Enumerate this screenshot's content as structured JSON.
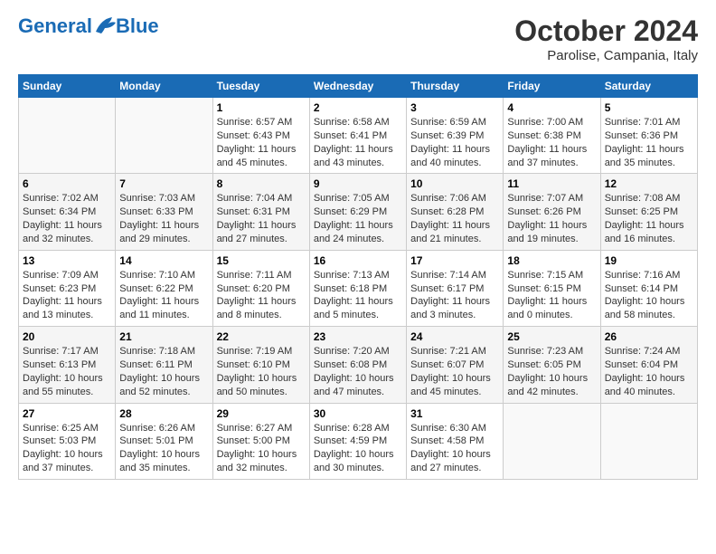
{
  "header": {
    "logo_line1": "General",
    "logo_line2": "Blue",
    "main_title": "October 2024",
    "subtitle": "Parolise, Campania, Italy"
  },
  "weekdays": [
    "Sunday",
    "Monday",
    "Tuesday",
    "Wednesday",
    "Thursday",
    "Friday",
    "Saturday"
  ],
  "weeks": [
    [
      {
        "num": "",
        "info": ""
      },
      {
        "num": "",
        "info": ""
      },
      {
        "num": "1",
        "info": "Sunrise: 6:57 AM\nSunset: 6:43 PM\nDaylight: 11 hours and 45 minutes."
      },
      {
        "num": "2",
        "info": "Sunrise: 6:58 AM\nSunset: 6:41 PM\nDaylight: 11 hours and 43 minutes."
      },
      {
        "num": "3",
        "info": "Sunrise: 6:59 AM\nSunset: 6:39 PM\nDaylight: 11 hours and 40 minutes."
      },
      {
        "num": "4",
        "info": "Sunrise: 7:00 AM\nSunset: 6:38 PM\nDaylight: 11 hours and 37 minutes."
      },
      {
        "num": "5",
        "info": "Sunrise: 7:01 AM\nSunset: 6:36 PM\nDaylight: 11 hours and 35 minutes."
      }
    ],
    [
      {
        "num": "6",
        "info": "Sunrise: 7:02 AM\nSunset: 6:34 PM\nDaylight: 11 hours and 32 minutes."
      },
      {
        "num": "7",
        "info": "Sunrise: 7:03 AM\nSunset: 6:33 PM\nDaylight: 11 hours and 29 minutes."
      },
      {
        "num": "8",
        "info": "Sunrise: 7:04 AM\nSunset: 6:31 PM\nDaylight: 11 hours and 27 minutes."
      },
      {
        "num": "9",
        "info": "Sunrise: 7:05 AM\nSunset: 6:29 PM\nDaylight: 11 hours and 24 minutes."
      },
      {
        "num": "10",
        "info": "Sunrise: 7:06 AM\nSunset: 6:28 PM\nDaylight: 11 hours and 21 minutes."
      },
      {
        "num": "11",
        "info": "Sunrise: 7:07 AM\nSunset: 6:26 PM\nDaylight: 11 hours and 19 minutes."
      },
      {
        "num": "12",
        "info": "Sunrise: 7:08 AM\nSunset: 6:25 PM\nDaylight: 11 hours and 16 minutes."
      }
    ],
    [
      {
        "num": "13",
        "info": "Sunrise: 7:09 AM\nSunset: 6:23 PM\nDaylight: 11 hours and 13 minutes."
      },
      {
        "num": "14",
        "info": "Sunrise: 7:10 AM\nSunset: 6:22 PM\nDaylight: 11 hours and 11 minutes."
      },
      {
        "num": "15",
        "info": "Sunrise: 7:11 AM\nSunset: 6:20 PM\nDaylight: 11 hours and 8 minutes."
      },
      {
        "num": "16",
        "info": "Sunrise: 7:13 AM\nSunset: 6:18 PM\nDaylight: 11 hours and 5 minutes."
      },
      {
        "num": "17",
        "info": "Sunrise: 7:14 AM\nSunset: 6:17 PM\nDaylight: 11 hours and 3 minutes."
      },
      {
        "num": "18",
        "info": "Sunrise: 7:15 AM\nSunset: 6:15 PM\nDaylight: 11 hours and 0 minutes."
      },
      {
        "num": "19",
        "info": "Sunrise: 7:16 AM\nSunset: 6:14 PM\nDaylight: 10 hours and 58 minutes."
      }
    ],
    [
      {
        "num": "20",
        "info": "Sunrise: 7:17 AM\nSunset: 6:13 PM\nDaylight: 10 hours and 55 minutes."
      },
      {
        "num": "21",
        "info": "Sunrise: 7:18 AM\nSunset: 6:11 PM\nDaylight: 10 hours and 52 minutes."
      },
      {
        "num": "22",
        "info": "Sunrise: 7:19 AM\nSunset: 6:10 PM\nDaylight: 10 hours and 50 minutes."
      },
      {
        "num": "23",
        "info": "Sunrise: 7:20 AM\nSunset: 6:08 PM\nDaylight: 10 hours and 47 minutes."
      },
      {
        "num": "24",
        "info": "Sunrise: 7:21 AM\nSunset: 6:07 PM\nDaylight: 10 hours and 45 minutes."
      },
      {
        "num": "25",
        "info": "Sunrise: 7:23 AM\nSunset: 6:05 PM\nDaylight: 10 hours and 42 minutes."
      },
      {
        "num": "26",
        "info": "Sunrise: 7:24 AM\nSunset: 6:04 PM\nDaylight: 10 hours and 40 minutes."
      }
    ],
    [
      {
        "num": "27",
        "info": "Sunrise: 6:25 AM\nSunset: 5:03 PM\nDaylight: 10 hours and 37 minutes."
      },
      {
        "num": "28",
        "info": "Sunrise: 6:26 AM\nSunset: 5:01 PM\nDaylight: 10 hours and 35 minutes."
      },
      {
        "num": "29",
        "info": "Sunrise: 6:27 AM\nSunset: 5:00 PM\nDaylight: 10 hours and 32 minutes."
      },
      {
        "num": "30",
        "info": "Sunrise: 6:28 AM\nSunset: 4:59 PM\nDaylight: 10 hours and 30 minutes."
      },
      {
        "num": "31",
        "info": "Sunrise: 6:30 AM\nSunset: 4:58 PM\nDaylight: 10 hours and 27 minutes."
      },
      {
        "num": "",
        "info": ""
      },
      {
        "num": "",
        "info": ""
      }
    ]
  ]
}
